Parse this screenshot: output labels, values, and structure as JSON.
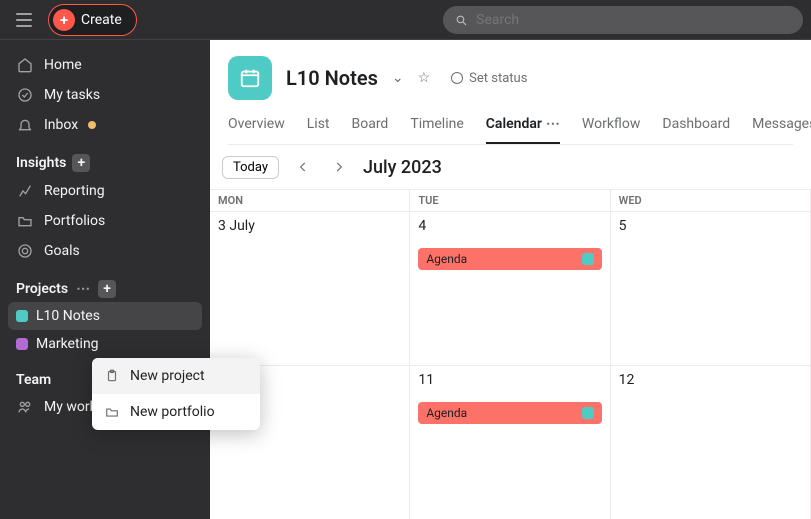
{
  "topbar": {
    "create_label": "Create",
    "search_placeholder": "Search"
  },
  "sidebar": {
    "nav": {
      "home": "Home",
      "mytasks": "My tasks",
      "inbox": "Inbox"
    },
    "insights": {
      "label": "Insights",
      "reporting": "Reporting",
      "portfolios": "Portfolios",
      "goals": "Goals"
    },
    "projects": {
      "label": "Projects",
      "items": [
        {
          "label": "L10 Notes",
          "color": "#4ecbc4",
          "active": true
        },
        {
          "label": "Marketing",
          "color": "#b36bd4",
          "active": false
        }
      ]
    },
    "team": {
      "label": "Team",
      "workspace": "My workspace"
    },
    "popup": {
      "new_project": "New project",
      "new_portfolio": "New portfolio"
    }
  },
  "project": {
    "title": "L10 Notes",
    "set_status": "Set status",
    "tabs": {
      "overview": "Overview",
      "list": "List",
      "board": "Board",
      "timeline": "Timeline",
      "calendar": "Calendar",
      "workflow": "Workflow",
      "dashboard": "Dashboard",
      "messages": "Messages"
    }
  },
  "calendar": {
    "today_label": "Today",
    "month_label": "July 2023",
    "dow": {
      "mon": "MON",
      "tue": "TUE",
      "wed": "WED"
    },
    "cells": {
      "w1c1": "3 July",
      "w1c2": "4",
      "w1c3": "5",
      "w2c1": "",
      "w2c2": "11",
      "w2c3": "12"
    },
    "events": {
      "agenda1": "Agenda",
      "agenda2": "Agenda"
    }
  }
}
